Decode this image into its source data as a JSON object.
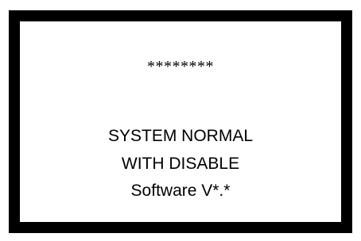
{
  "display": {
    "masked_line": "********",
    "status_line_1": "SYSTEM NORMAL",
    "status_line_2": "WITH DISABLE",
    "software_version": "Software V*.*"
  },
  "colors": {
    "background": "#ffffff",
    "border": "#000000",
    "text": "#000000"
  }
}
